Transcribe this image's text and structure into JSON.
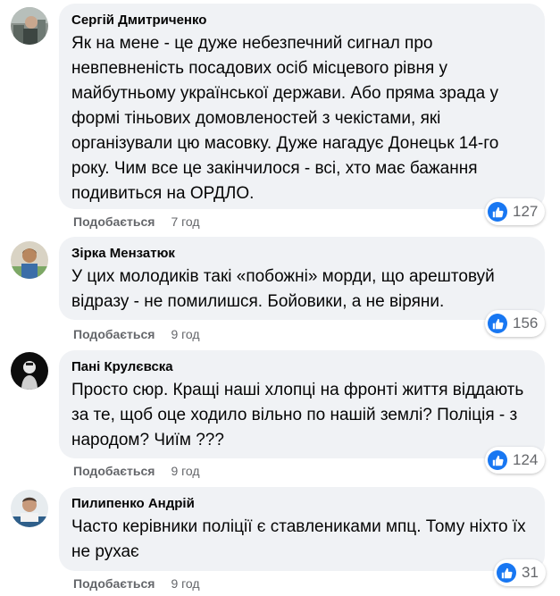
{
  "colors": {
    "bubble_bg": "#f0f2f5",
    "text_primary": "#050505",
    "text_secondary": "#65676b",
    "like_blue": "#1877f2"
  },
  "comments": [
    {
      "author": "Сергій Дмитриченко",
      "text": "Як на мене - це дуже небезпечний сигнал про невпевненість посадових осіб місцевого рівня у майбутньому української держави. Або пряма зрада у формі тіньових домовленостей з чекістами, які організували цю масовку. Дуже нагадує Донецьк 14-го року. Чим все це закінчилося - всі, хто має бажання подивиться на ОРДЛО.",
      "like_label": "Подобається",
      "time": "7 год",
      "reaction_icon": "thumbs-up-icon",
      "reaction_count": "127"
    },
    {
      "author": "Зірка Мензатюк",
      "text": "У цих молодиків такі «побожні» морди, що арештовуй відразу - не помилишся. Бойовики, а не віряни.",
      "like_label": "Подобається",
      "time": "9 год",
      "reaction_icon": "thumbs-up-icon",
      "reaction_count": "156"
    },
    {
      "author": "Пані Крулєвска",
      "text": "Просто сюр. Кращі наші хлопці на фронті життя віддають за те, щоб оце ходило вільно по нашій землі? Поліція - з народом? Чиїм ???",
      "like_label": "Подобається",
      "time": "9 год",
      "reaction_icon": "thumbs-up-icon",
      "reaction_count": "124"
    },
    {
      "author": "Пилипенко Андрій",
      "text": "Часто керівники поліції є ставлениками мпц. Тому ніхто їх не рухає",
      "like_label": "Подобається",
      "time": "9 год",
      "reaction_icon": "thumbs-up-icon",
      "reaction_count": "31"
    }
  ]
}
